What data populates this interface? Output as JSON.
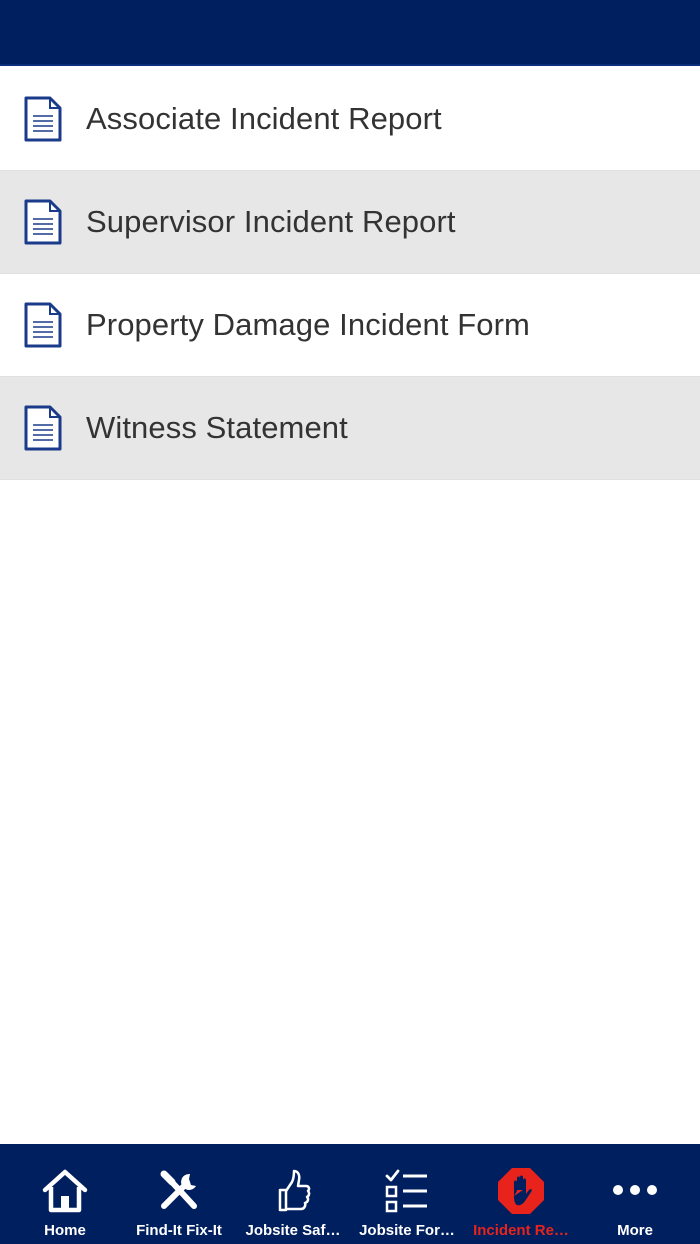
{
  "header": {
    "title": ""
  },
  "forms": {
    "items": [
      {
        "label": "Associate Incident Report",
        "icon": "document-icon"
      },
      {
        "label": "Supervisor Incident Report",
        "icon": "document-icon"
      },
      {
        "label": "Property Damage Incident Form",
        "icon": "document-icon"
      },
      {
        "label": "Witness Statement",
        "icon": "document-icon"
      }
    ]
  },
  "tabbar": {
    "items": [
      {
        "label": "Home",
        "icon": "home-icon",
        "active": false
      },
      {
        "label": "Find-It Fix-It",
        "icon": "tools-icon",
        "active": false
      },
      {
        "label": "Jobsite Saf…",
        "icon": "thumbs-up-icon",
        "active": false
      },
      {
        "label": "Jobsite For…",
        "icon": "checklist-icon",
        "active": false
      },
      {
        "label": "Incident Re…",
        "icon": "stop-hand-icon",
        "active": true
      },
      {
        "label": "More",
        "icon": "more-icon",
        "active": false
      }
    ]
  },
  "colors": {
    "nav_background": "#001f5f",
    "active_tab": "#e8231b",
    "icon_blue": "#1a3a8a",
    "row_alternate": "#e7e7e7"
  }
}
